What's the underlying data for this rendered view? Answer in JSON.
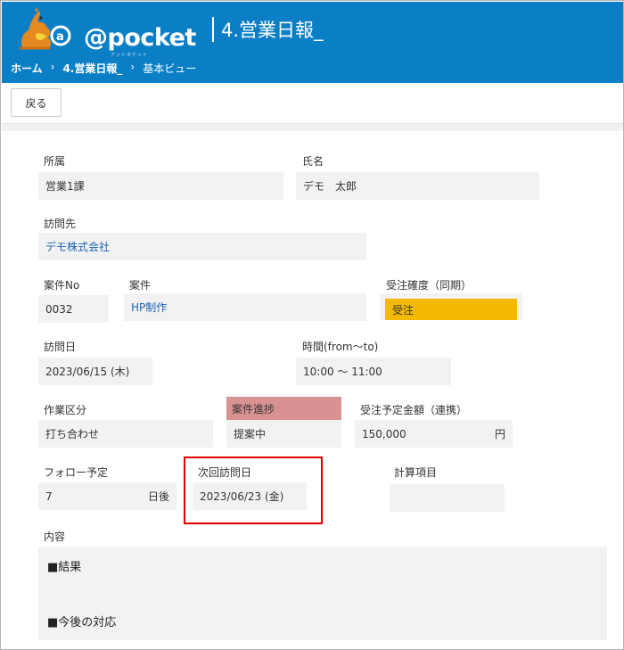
{
  "header": {
    "logo_text": "@pocket",
    "logo_sub": "アットポケット",
    "app_title": "4.営業日報_",
    "breadcrumb": {
      "home": "ホーム",
      "sep1": "›",
      "app": "4.営業日報_",
      "sep2": "›",
      "view": "基本ビュー"
    }
  },
  "toolbar": {
    "back_label": "戻る"
  },
  "form": {
    "affiliation": {
      "label": "所属",
      "value": "営業1課"
    },
    "name": {
      "label": "氏名",
      "value": "デモ　太郎"
    },
    "visit_to": {
      "label": "訪問先",
      "value": "デモ株式会社"
    },
    "case_no": {
      "label": "案件No",
      "value": "0032"
    },
    "case": {
      "label": "案件",
      "value": "HP制作"
    },
    "order_certainty": {
      "label": "受注確度（同期）",
      "value": "受注"
    },
    "visit_date": {
      "label": "訪問日",
      "value": "2023/06/15 (木)"
    },
    "time": {
      "label": "時間(from〜to)",
      "value": "10:00 〜 11:00"
    },
    "work_type": {
      "label": "作業区分",
      "value": "打ち合わせ"
    },
    "case_progress": {
      "label": "案件進捗",
      "value": "提案中"
    },
    "order_amount": {
      "label": "受注予定金額（連携）",
      "value": "150,000",
      "unit": "円"
    },
    "follow_up": {
      "label": "フォロー予定",
      "value": "7",
      "unit": "日後"
    },
    "next_visit": {
      "label": "次回訪問日",
      "value": "2023/06/23 (金)"
    },
    "calc_item": {
      "label": "計算項目",
      "value": ""
    },
    "content": {
      "label": "内容",
      "line1": "■結果",
      "line2": "■今後の対応"
    }
  },
  "colors": {
    "header_bg": "#0b7fc6",
    "gold": "#f5b800",
    "progress_label_bg": "#d89292",
    "highlight": "#e00000"
  }
}
